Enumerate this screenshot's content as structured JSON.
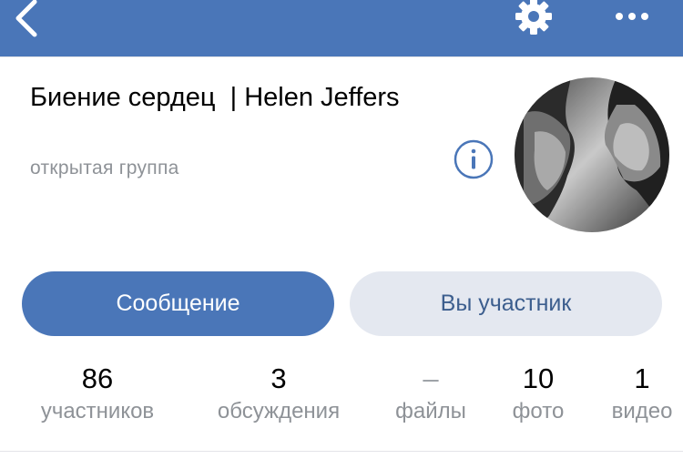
{
  "colors": {
    "header": "#4a76b8",
    "primary": "#4a76b8",
    "secondary_bg": "#e4e8f0",
    "muted": "#8e9297"
  },
  "header": {
    "back_icon": "back-icon",
    "settings_icon": "gear-icon",
    "more_icon": "more-icon"
  },
  "group": {
    "title": "Биение сердец  | Helen Jeffers",
    "type": "открытая группа",
    "info_icon": "info-icon",
    "avatar": "avatar"
  },
  "actions": {
    "message_label": "Сообщение",
    "member_label": "Вы участник"
  },
  "stats": [
    {
      "value": "86",
      "label": "участников"
    },
    {
      "value": "3",
      "label": "обсуждения"
    },
    {
      "value": "–",
      "label": "файлы"
    },
    {
      "value": "10",
      "label": "фото"
    },
    {
      "value": "1",
      "label": "видео"
    }
  ]
}
